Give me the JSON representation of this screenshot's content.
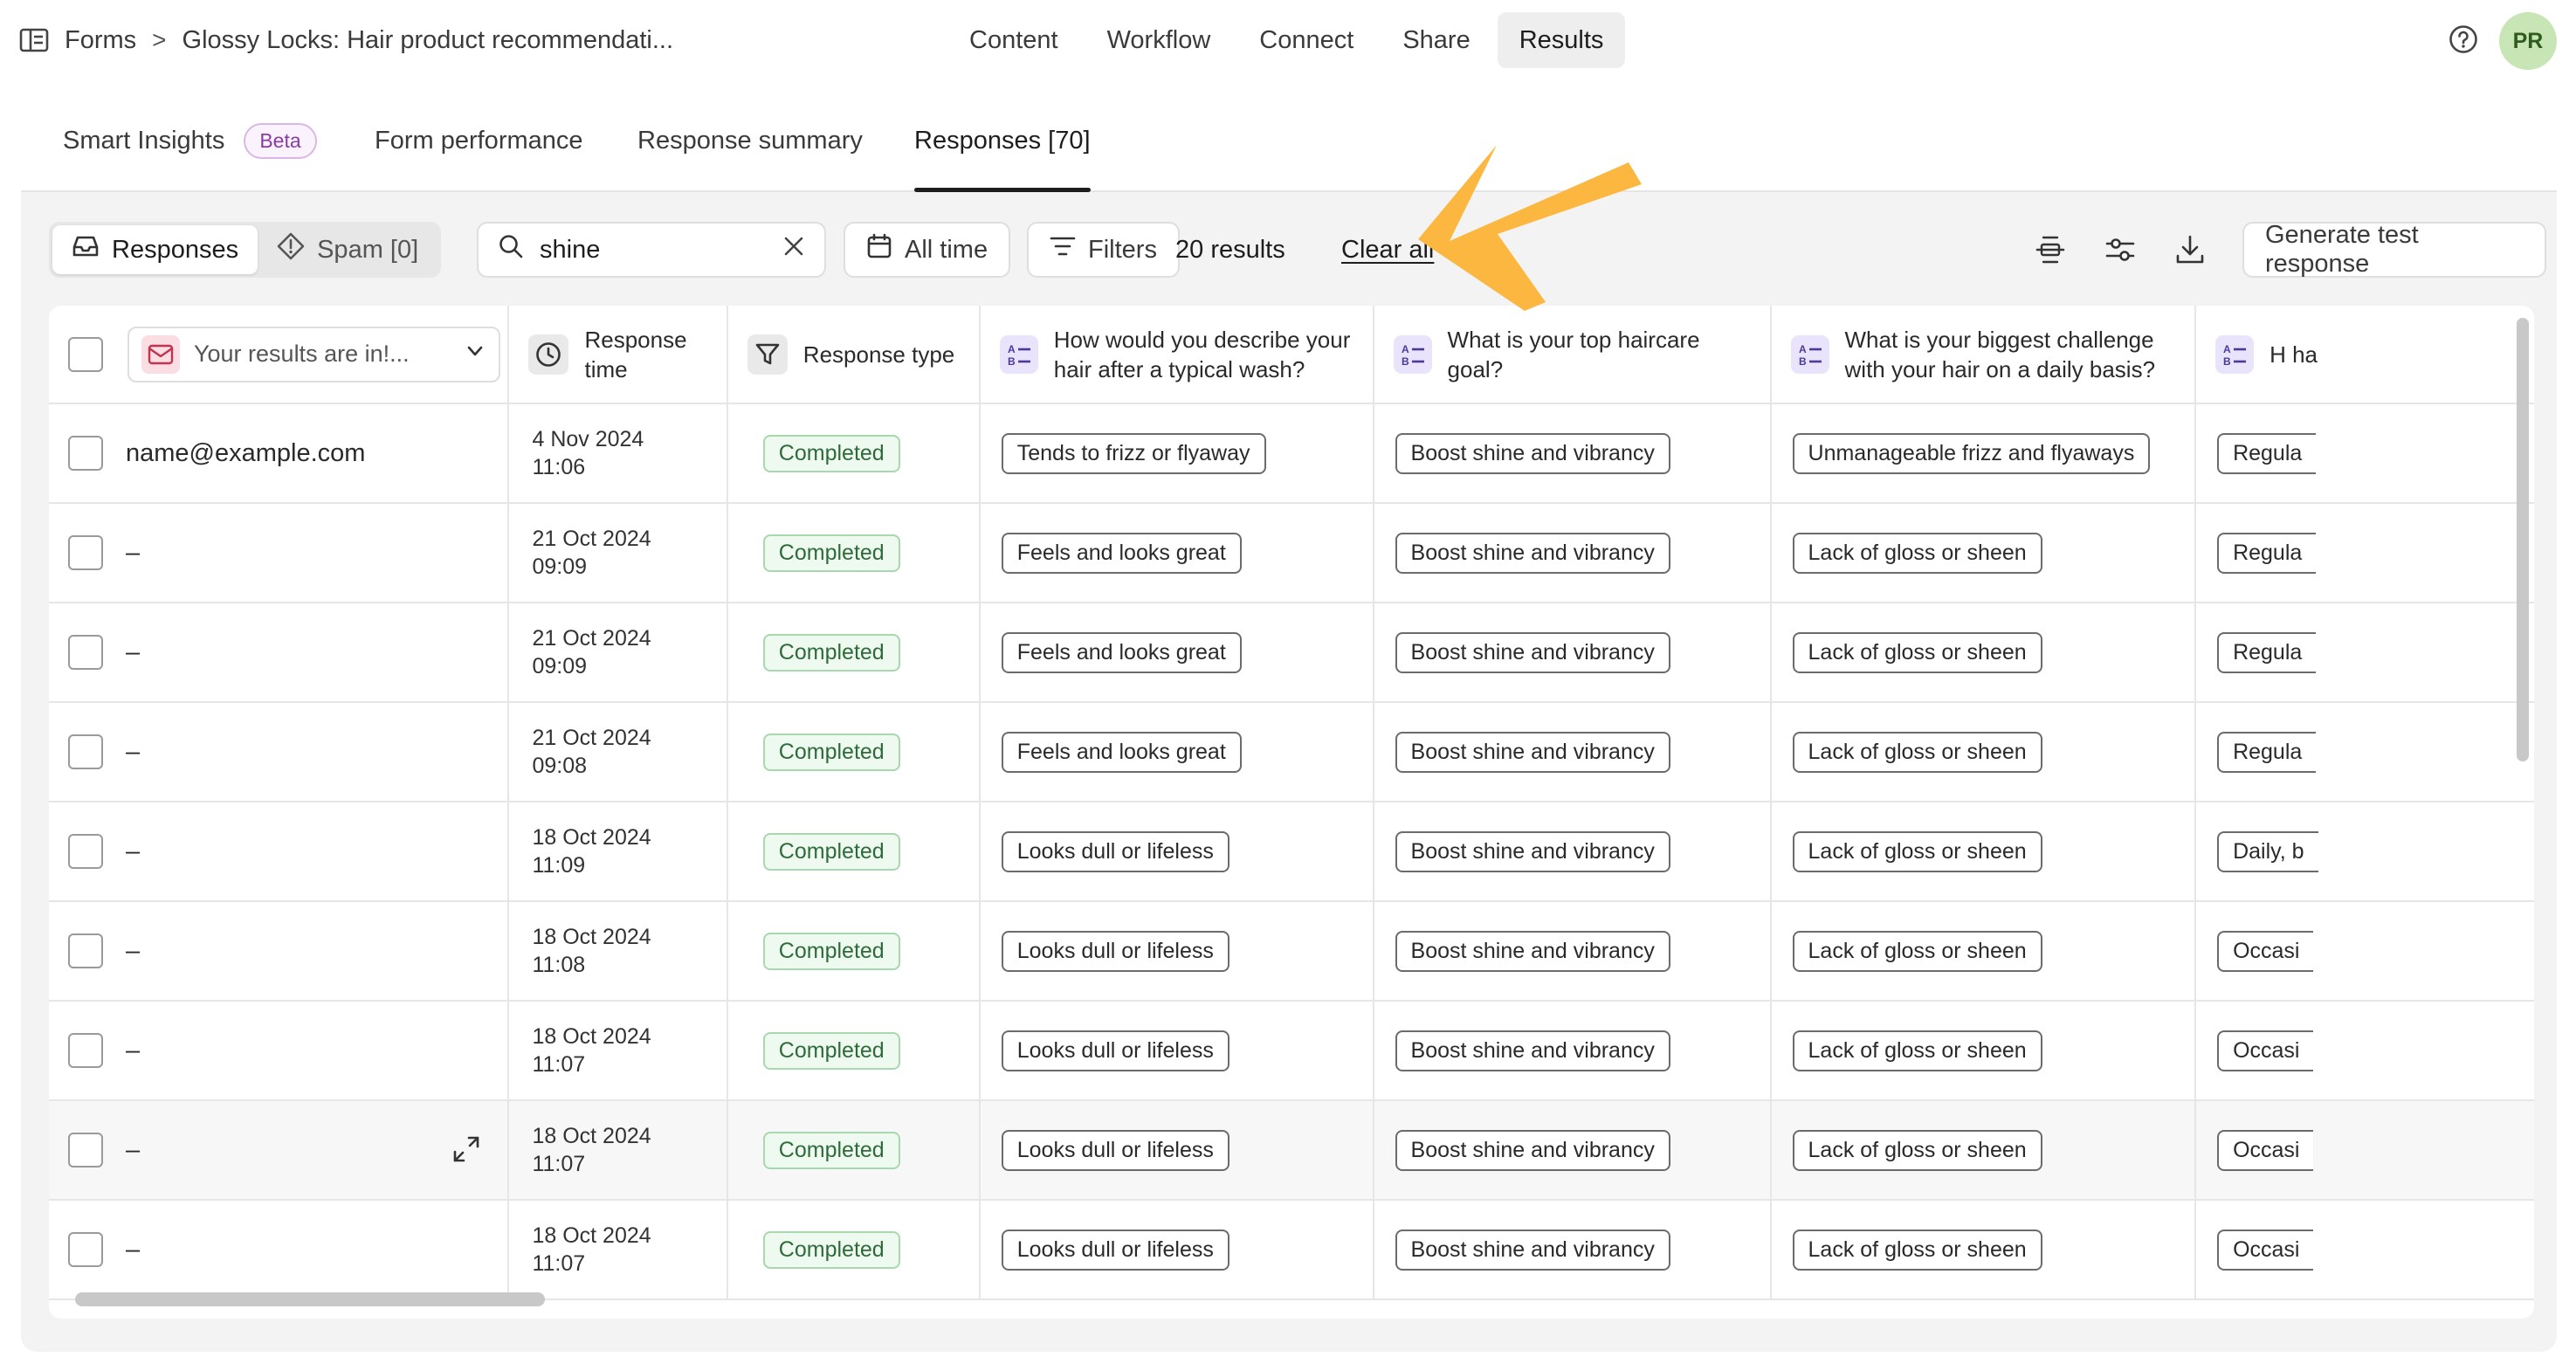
{
  "breadcrumb": {
    "root": "Forms",
    "separator": ">",
    "form_title": "Glossy Locks: Hair product recommendati..."
  },
  "top_nav": [
    {
      "label": "Content",
      "active": false
    },
    {
      "label": "Workflow",
      "active": false
    },
    {
      "label": "Connect",
      "active": false
    },
    {
      "label": "Share",
      "active": false
    },
    {
      "label": "Results",
      "active": true
    }
  ],
  "user": {
    "initials": "PR"
  },
  "sub_tabs": {
    "smart_insights": "Smart Insights",
    "beta_badge": "Beta",
    "form_performance": "Form performance",
    "response_summary": "Response summary",
    "responses": "Responses [70]"
  },
  "toolbar": {
    "responses_toggle": "Responses",
    "spam_toggle": "Spam [0]",
    "search_value": "shine",
    "date_filter": "All time",
    "filters": "Filters",
    "results_count": "20 results",
    "clear_all": "Clear all",
    "generate_test": "Generate test response"
  },
  "table": {
    "email_column_placeholder": "Your results are in!...",
    "headers": {
      "response_time": "Response time",
      "response_type": "Response type",
      "q1": "How would you describe your hair after a typical wash?",
      "q2": "What is your top haircare goal?",
      "q3": "What is your biggest challenge with your hair on a daily basis?",
      "q4": "H ha"
    },
    "rows": [
      {
        "email": "name@example.com",
        "date": "4 Nov 2024",
        "time": "11:06",
        "type": "Completed",
        "q1": "Tends to frizz or flyaway",
        "q2": "Boost shine and vibrancy",
        "q3": "Unmanageable frizz and flyaways",
        "q4": "Regula"
      },
      {
        "email": "–",
        "date": "21 Oct 2024",
        "time": "09:09",
        "type": "Completed",
        "q1": "Feels and looks great",
        "q2": "Boost shine and vibrancy",
        "q3": "Lack of gloss or sheen",
        "q4": "Regula"
      },
      {
        "email": "–",
        "date": "21 Oct 2024",
        "time": "09:09",
        "type": "Completed",
        "q1": "Feels and looks great",
        "q2": "Boost shine and vibrancy",
        "q3": "Lack of gloss or sheen",
        "q4": "Regula"
      },
      {
        "email": "–",
        "date": "21 Oct 2024",
        "time": "09:08",
        "type": "Completed",
        "q1": "Feels and looks great",
        "q2": "Boost shine and vibrancy",
        "q3": "Lack of gloss or sheen",
        "q4": "Regula"
      },
      {
        "email": "–",
        "date": "18 Oct 2024",
        "time": "11:09",
        "type": "Completed",
        "q1": "Looks dull or lifeless",
        "q2": "Boost shine and vibrancy",
        "q3": "Lack of gloss or sheen",
        "q4": "Daily, b"
      },
      {
        "email": "–",
        "date": "18 Oct 2024",
        "time": "11:08",
        "type": "Completed",
        "q1": "Looks dull or lifeless",
        "q2": "Boost shine and vibrancy",
        "q3": "Lack of gloss or sheen",
        "q4": "Occasi"
      },
      {
        "email": "–",
        "date": "18 Oct 2024",
        "time": "11:07",
        "type": "Completed",
        "q1": "Looks dull or lifeless",
        "q2": "Boost shine and vibrancy",
        "q3": "Lack of gloss or sheen",
        "q4": "Occasi"
      },
      {
        "email": "–",
        "date": "18 Oct 2024",
        "time": "11:07",
        "type": "Completed",
        "q1": "Looks dull or lifeless",
        "q2": "Boost shine and vibrancy",
        "q3": "Lack of gloss or sheen",
        "q4": "Occasi"
      },
      {
        "email": "–",
        "date": "18 Oct 2024",
        "time": "11:07",
        "type": "Completed",
        "q1": "Looks dull or lifeless",
        "q2": "Boost shine and vibrancy",
        "q3": "Lack of gloss or sheen",
        "q4": "Occasi"
      }
    ]
  },
  "colors": {
    "annotation_arrow": "#fbb73f",
    "completed_badge": "#2f6b3a",
    "avatar_bg": "#c8e6b5"
  }
}
